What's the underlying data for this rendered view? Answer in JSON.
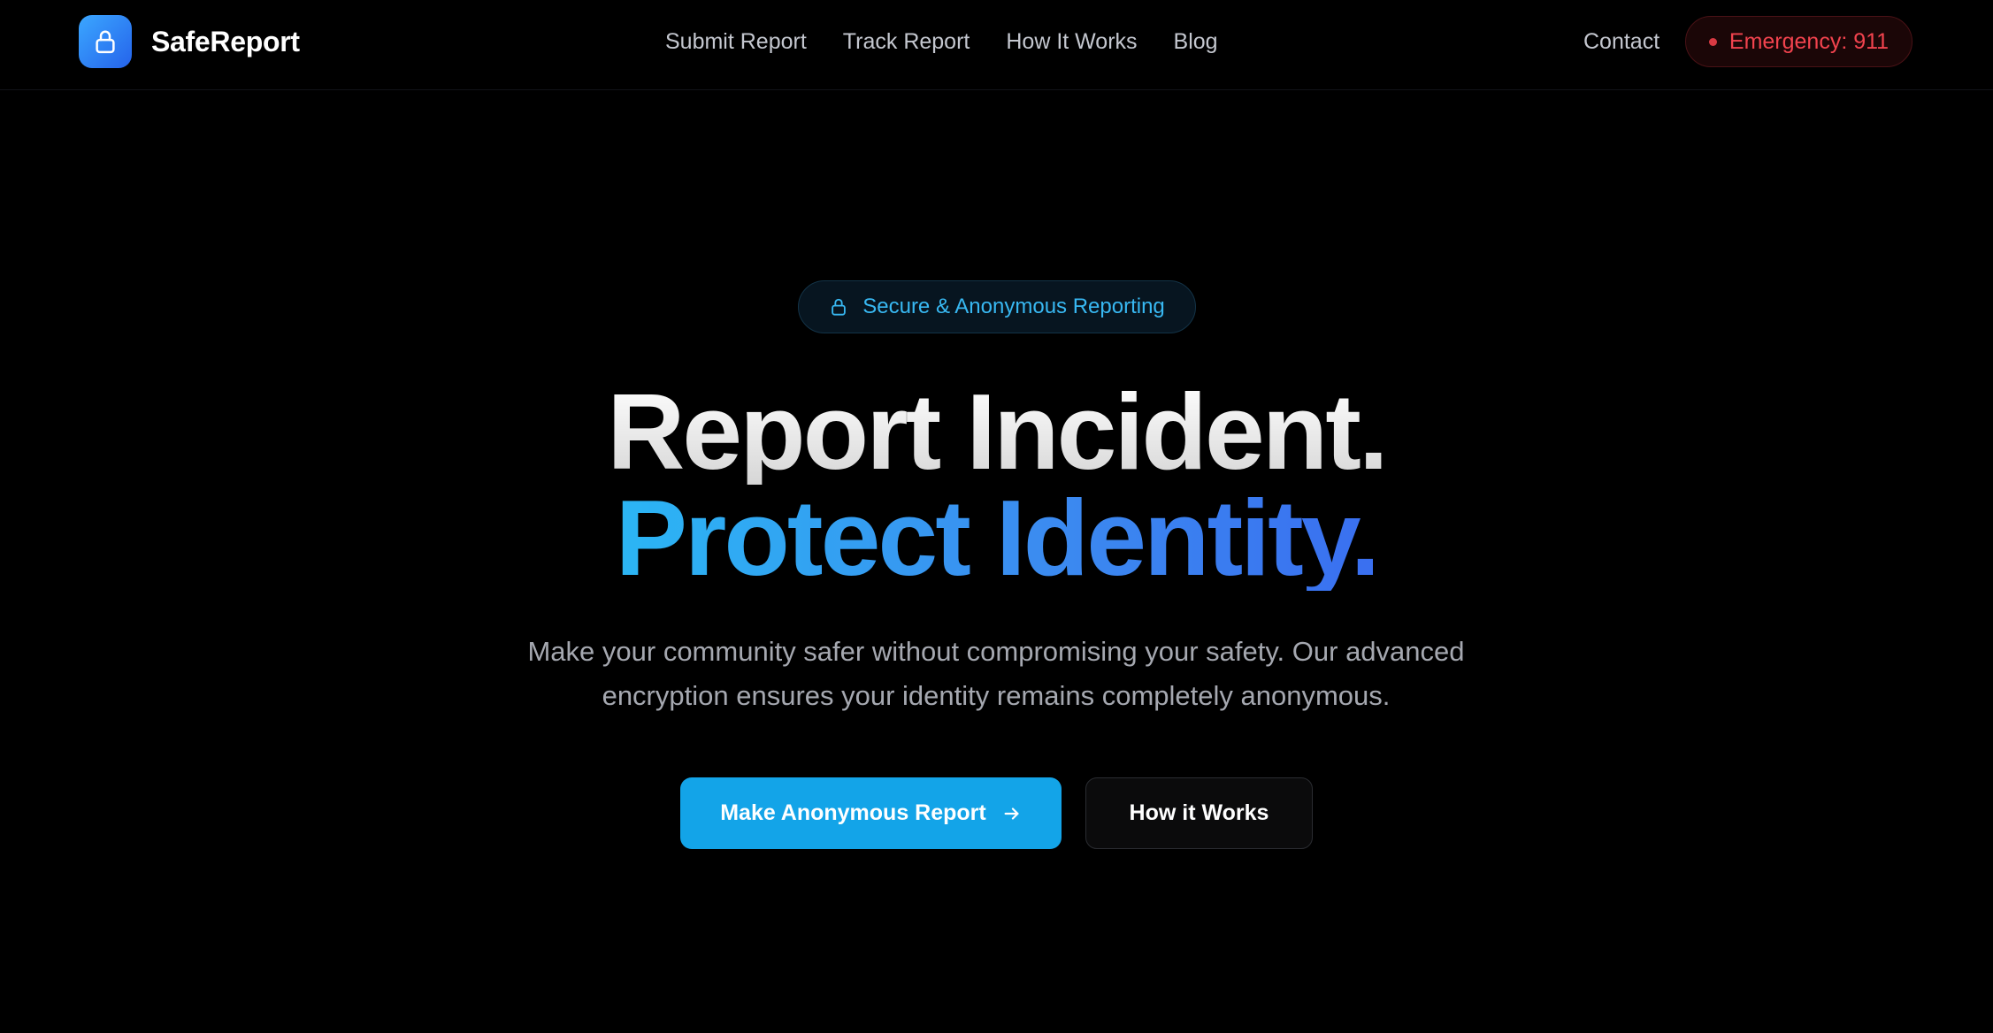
{
  "header": {
    "brand": {
      "name": "SafeReport",
      "logo_icon": "lock-icon"
    },
    "nav": [
      {
        "label": "Submit Report"
      },
      {
        "label": "Track Report"
      },
      {
        "label": "How It Works"
      },
      {
        "label": "Blog"
      }
    ],
    "contact_label": "Contact",
    "emergency_label": "Emergency: 911"
  },
  "hero": {
    "badge": {
      "label": "Secure & Anonymous Reporting",
      "icon": "lock-icon"
    },
    "headline_line1": "Report Incident.",
    "headline_line2": "Protect Identity.",
    "subtext_line1": "Make your community safer without compromising your safety. Our advanced",
    "subtext_line2": "encryption ensures your identity remains completely anonymous.",
    "primary_cta": {
      "label": "Make Anonymous Report",
      "icon": "arrow-right-icon"
    },
    "secondary_cta": {
      "label": "How it Works"
    }
  },
  "colors": {
    "background": "#000000",
    "accent": "#13a4e8",
    "emergency": "#f2434e",
    "badge_text": "#38b8f2"
  }
}
